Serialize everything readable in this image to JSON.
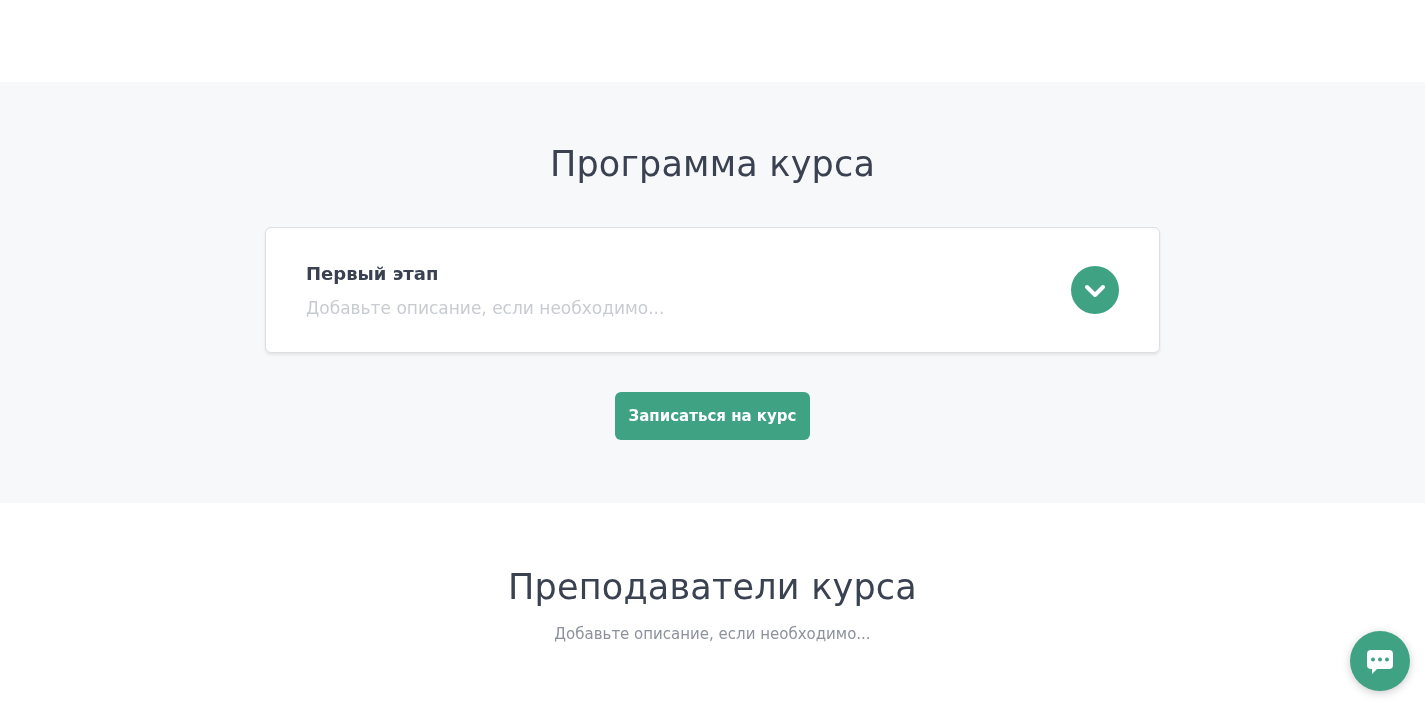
{
  "program": {
    "title": "Программа курса",
    "stages": [
      {
        "title": "Первый этап",
        "description": "Добавьте описание, если необходимо...",
        "expanded": false
      }
    ],
    "enroll_button": "Записаться на курс"
  },
  "teachers": {
    "title": "Преподаватели курса",
    "description": "Добавьте описание, если необходимо..."
  }
}
